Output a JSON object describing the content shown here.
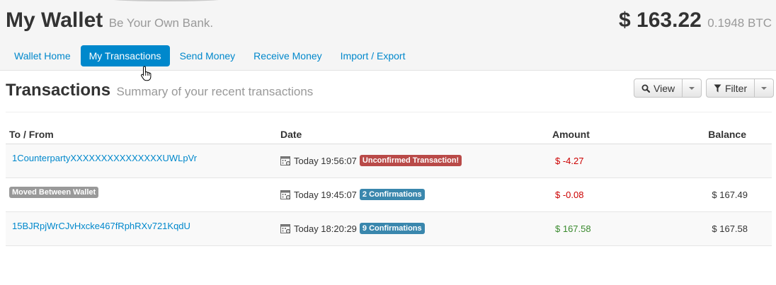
{
  "header": {
    "title": "My Wallet",
    "tagline": "Be Your Own Bank.",
    "balance_usd": "$ 163.22",
    "balance_btc": "0.1948 BTC"
  },
  "nav": {
    "items": [
      {
        "label": "Wallet Home",
        "active": false
      },
      {
        "label": "My Transactions",
        "active": true
      },
      {
        "label": "Send Money",
        "active": false
      },
      {
        "label": "Receive Money",
        "active": false
      },
      {
        "label": "Import / Export",
        "active": false
      }
    ]
  },
  "section": {
    "title": "Transactions",
    "subtitle": "Summary of your recent transactions"
  },
  "toolbar": {
    "view_label": "View",
    "filter_label": "Filter"
  },
  "table": {
    "headers": {
      "to_from": "To / From",
      "date": "Date",
      "amount": "Amount",
      "balance": "Balance"
    },
    "rows": [
      {
        "to_from": "1CounterpartyXXXXXXXXXXXXXXXUWLpVr",
        "to_from_type": "link",
        "date": "Today 19:56:07",
        "status": "Unconfirmed Transaction!",
        "status_color": "#b94a48",
        "amount": "$ -4.27",
        "amount_sign": "negative",
        "balance": ""
      },
      {
        "to_from": "Moved Between Wallet",
        "to_from_type": "badge",
        "date": "Today 19:45:07",
        "status": "2 Confirmations",
        "status_color": "#3a87ad",
        "amount": "$ -0.08",
        "amount_sign": "negative",
        "balance": "$ 167.49"
      },
      {
        "to_from": "15BJRpjWrCJvHxcke467fRphRXv721KqdU",
        "to_from_type": "link",
        "date": "Today 18:20:29",
        "status": "9 Confirmations",
        "status_color": "#3a87ad",
        "amount": "$ 167.58",
        "amount_sign": "positive",
        "balance": "$ 167.58"
      }
    ]
  },
  "colors": {
    "accent": "#0088cc",
    "negative": "#cc0000",
    "positive": "#3a8a2e"
  },
  "icons": {
    "view": "magnifier-icon",
    "filter": "funnel-icon",
    "date": "calendar-icon",
    "cursor": "hand-pointer-icon"
  }
}
